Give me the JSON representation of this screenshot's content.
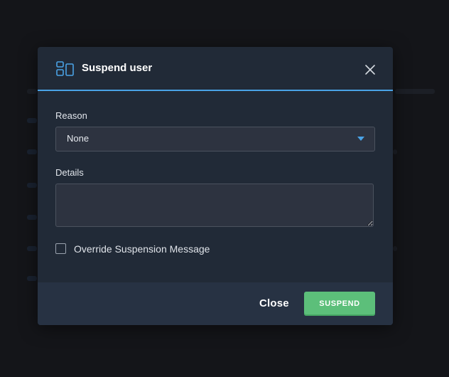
{
  "modal": {
    "title": "Suspend user",
    "header_icon": "layout-panels-icon",
    "close_icon": "close-icon"
  },
  "form": {
    "reason_label": "Reason",
    "reason_value": "None",
    "reason_caret_icon": "caret-down-icon",
    "details_label": "Details",
    "details_value": "",
    "override_label": "Override Suspension Message",
    "override_checked": false
  },
  "footer": {
    "close_label": "Close",
    "suspend_label": "SUSPEND"
  },
  "colors": {
    "accent": "#4aa3e6",
    "suspend_button": "#5cbf7a",
    "modal_bg": "#212a37",
    "footer_bg": "#273243",
    "backdrop": "#141519"
  }
}
